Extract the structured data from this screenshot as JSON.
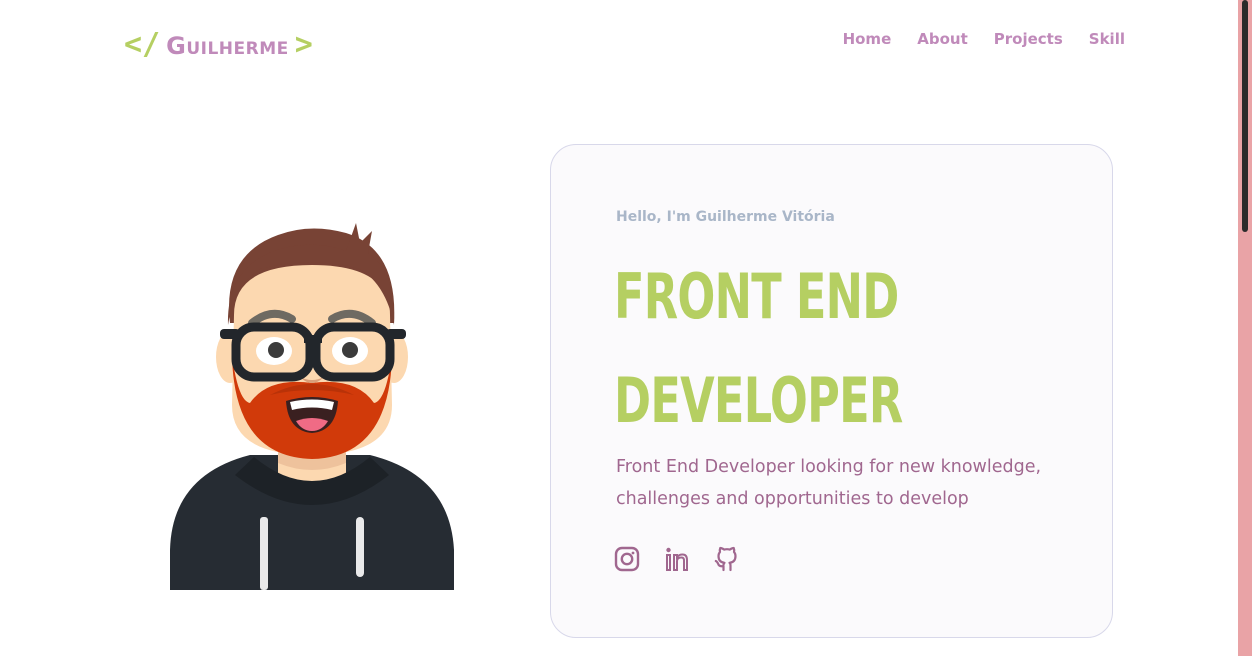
{
  "header": {
    "logo": {
      "open": "</",
      "name": "Guilherme",
      "close": ">"
    },
    "nav": [
      {
        "label": "Home"
      },
      {
        "label": "About"
      },
      {
        "label": "Projects"
      },
      {
        "label": "Skill"
      }
    ]
  },
  "hero": {
    "greeting": "Hello, I'm Guilherme Vitória",
    "headline": "FRONT END\nDEVELOPER",
    "description": "Front End Developer looking for new knowledge, challenges and opportunities to develop",
    "socials": [
      {
        "icon": "instagram-icon"
      },
      {
        "icon": "linkedin-icon"
      },
      {
        "icon": "github-icon"
      }
    ]
  },
  "colors": {
    "accent_green": "#b5cf62",
    "accent_purple": "#c08aba",
    "greeting_gray": "#a9b6c8",
    "text_mauve": "#a0678f"
  }
}
